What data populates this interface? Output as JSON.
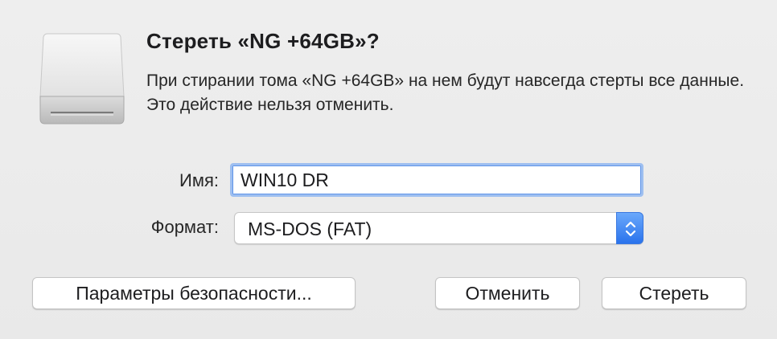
{
  "dialog": {
    "title": "Стереть «NG +64GB»?",
    "message": "При стирании тома «NG +64GB» на нем будут навсегда стерты все данные. Это действие нельзя отменить.",
    "icon": "external-drive-icon"
  },
  "form": {
    "name_label": "Имя:",
    "name_value": "WIN10 DR",
    "format_label": "Формат:",
    "format_value": "MS-DOS (FAT)",
    "stepper_icon": "chevron-up-down-icon"
  },
  "buttons": {
    "security_options": "Параметры безопасности...",
    "cancel": "Отменить",
    "erase": "Стереть"
  },
  "colors": {
    "background": "#ececec",
    "focus_ring": "#9ebff0",
    "accent": "#2a73ec"
  }
}
